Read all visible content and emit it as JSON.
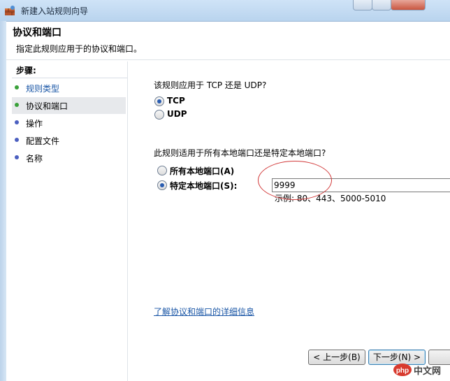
{
  "window": {
    "title": "新建入站规则向导"
  },
  "header": {
    "title": "协议和端口",
    "subtitle": "指定此规则应用于的协议和端口。"
  },
  "sidebar": {
    "label": "步骤:",
    "items": [
      {
        "label": "规则类型",
        "dot_color": "#3aa13a",
        "link": true
      },
      {
        "label": "协议和端口",
        "dot_color": "#3aa13a",
        "active": true
      },
      {
        "label": "操作",
        "dot_color": "#4b5fc0"
      },
      {
        "label": "配置文件",
        "dot_color": "#4b5fc0"
      },
      {
        "label": "名称",
        "dot_color": "#4b5fc0"
      }
    ]
  },
  "main": {
    "protocol_question": "该规则应用于 TCP 还是 UDP?",
    "protocols": [
      {
        "label": "TCP",
        "selected": true
      },
      {
        "label": "UDP",
        "selected": false
      }
    ],
    "ports_question": "此规则适用于所有本地端口还是特定本地端口?",
    "port_options": [
      {
        "label": "所有本地端口(A)",
        "selected": false
      },
      {
        "label": "特定本地端口(S):",
        "selected": true
      }
    ],
    "port_value": "9999",
    "port_example": "示例: 80、443、5000-5010",
    "learn_more": "了解协议和端口的详细信息"
  },
  "buttons": {
    "back": "< 上一步(B)",
    "next": "下一步(N) >"
  },
  "watermark": {
    "text": "中文网",
    "badge": "php"
  }
}
